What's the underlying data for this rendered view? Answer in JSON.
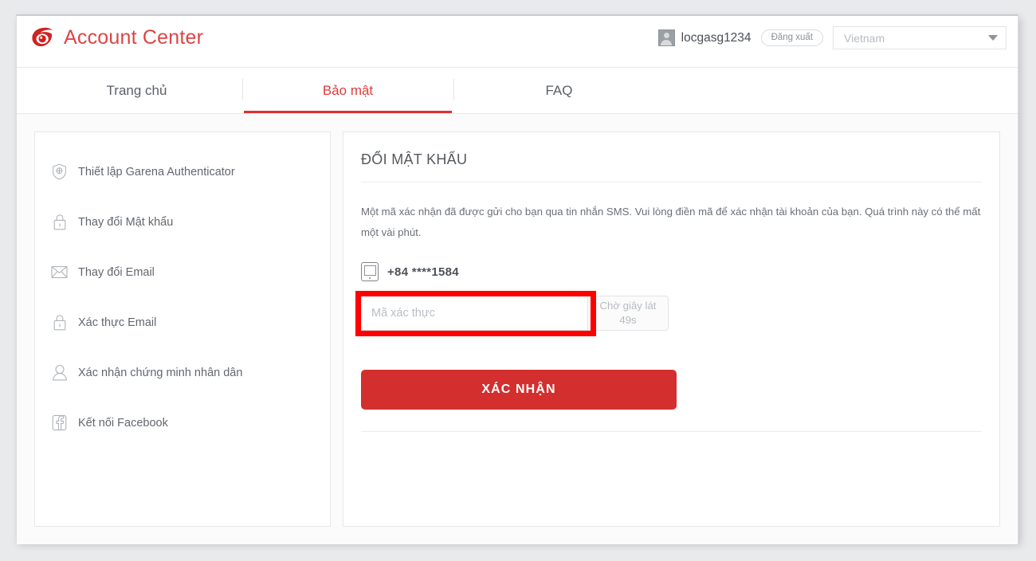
{
  "header": {
    "brand_title": "Account Center",
    "logo_icon": "garena-logo-icon",
    "username": "locgasg1234",
    "logout_label": "Đăng xuất",
    "country_value": "Vietnam",
    "brand_color": "#dd4444"
  },
  "tabs": [
    {
      "label": "Trang chủ",
      "active": false
    },
    {
      "label": "Bảo mật",
      "active": true
    },
    {
      "label": "FAQ",
      "active": false
    }
  ],
  "sidebar": {
    "items": [
      {
        "label": "Thiết lập Garena Authenticator",
        "icon": "shield-icon"
      },
      {
        "label": "Thay đổi Mật khẩu",
        "icon": "lock-icon"
      },
      {
        "label": "Thay đổi Email",
        "icon": "envelope-icon"
      },
      {
        "label": "Xác thực Email",
        "icon": "lock-icon"
      },
      {
        "label": "Xác nhận chứng minh nhân dân",
        "icon": "person-id-icon"
      },
      {
        "label": "Kết nối Facebook",
        "icon": "facebook-icon"
      }
    ]
  },
  "main": {
    "title": "ĐỔI MẬT KHẨU",
    "description": "Một mã xác nhận đã được gửi cho bạn qua tin nhắn SMS. Vui lòng điền mã để xác nhận tài khoản của bạn. Quá trình này có thể mất một vài phút.",
    "phone_number": "+84 ****1584",
    "phone_icon": "mobile-phone-icon",
    "code_input": {
      "value": "",
      "placeholder": "Mã xác thực"
    },
    "resend_button": {
      "line1": "Chờ giây lát",
      "line2": "49s",
      "disabled": true
    },
    "submit_label": "XÁC NHẬN",
    "submit_color": "#d32f2f",
    "highlight_color": "#ff0000"
  }
}
